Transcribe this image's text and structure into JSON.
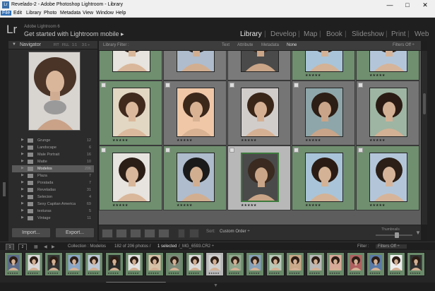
{
  "window": {
    "title": "Revelado-2 - Adobe Photoshop Lightroom - Library",
    "controls": [
      "minimize",
      "maximize",
      "close"
    ]
  },
  "menu": [
    "File",
    "Edit",
    "Library",
    "Photo",
    "Metadata",
    "View",
    "Window",
    "Help"
  ],
  "identity": {
    "logo": "Lr",
    "product": "Adobe Lightroom 6",
    "tagline": "Get started with Lightroom mobile  ▸"
  },
  "modules": [
    "Library",
    "Develop",
    "Map",
    "Book",
    "Slideshow",
    "Print",
    "Web"
  ],
  "active_module": "Library",
  "navigator": {
    "title": "Navigator",
    "options": [
      "FIT",
      "FILL",
      "1:1",
      "3:1 ÷"
    ]
  },
  "folders": [
    {
      "name": "Grunge",
      "count": "12"
    },
    {
      "name": "Landscape",
      "count": "6"
    },
    {
      "name": "Male Portrait",
      "count": "16"
    },
    {
      "name": "Matte",
      "count": "10"
    },
    {
      "name": "Modelos",
      "count": "206",
      "selected": true
    },
    {
      "name": "Plaza",
      "count": "7"
    },
    {
      "name": "Poratada",
      "count": "7"
    },
    {
      "name": "Reveladas",
      "count": "31"
    },
    {
      "name": "Selecion",
      "count": "4"
    },
    {
      "name": "Sexy Capitan America",
      "count": "69"
    },
    {
      "name": "texturas",
      "count": "5"
    },
    {
      "name": "Vintage",
      "count": "11"
    }
  ],
  "panel_buttons": {
    "import": "Import...",
    "export": "Export..."
  },
  "library_filter": {
    "label": "Library Filter :",
    "tabs": [
      "Text",
      "Attribute",
      "Metadata",
      "None"
    ],
    "active": "None",
    "filter_state": "Filters Off ÷"
  },
  "grid": {
    "rows": [
      [
        {
          "stars": "",
          "color": "#6f8f6f"
        },
        {
          "stars": "",
          "color": "#7a7a7a"
        },
        {
          "stars": "",
          "color": "#7a7a7a"
        },
        {
          "stars": "★★★★★",
          "color": "#6f8f6f"
        },
        {
          "stars": "★★★★★",
          "color": "#6f8f6f"
        }
      ],
      [
        {
          "stars": "★★★★★",
          "color": "#6f8f6f"
        },
        {
          "stars": "★★★★★",
          "color": "#757575"
        },
        {
          "stars": "★★★★★",
          "color": "#757575"
        },
        {
          "stars": "★★★★★",
          "color": "#757575"
        },
        {
          "stars": "★★★★★",
          "color": "#757575"
        }
      ],
      [
        {
          "stars": "★★★★★",
          "color": "#6f8f6f"
        },
        {
          "stars": "★★★★★",
          "color": "#6f8f6f"
        },
        {
          "stars": "★★★★★",
          "color": "#b8b8b8"
        },
        {
          "stars": "★★★★★",
          "color": "#6f8f6f"
        },
        {
          "stars": "★★★★★",
          "color": "#6f8f6f"
        }
      ]
    ]
  },
  "toolbar": {
    "sort_label": "Sort:",
    "sort_value": "Custom Order ÷",
    "thumbnails_label": "Thumbnails"
  },
  "filmstrip_bar": {
    "page1": "1",
    "page2": "2",
    "source": "Collection : Modelos",
    "count": "182 of 206 photos /",
    "selected": "1 selected",
    "filename": "/_MG_6593.CR2 ÷",
    "filter_label": "Filter :",
    "filter_value": "Filters Off ÷"
  },
  "filmstrip": {
    "count": 21,
    "selected_index": 10
  },
  "colors": {
    "bg": "#1e1e1e",
    "panel": "#2b2b2b",
    "grid_bg": "#5d5d5d",
    "cell": "#757575",
    "cell_selected": "#b8b8b8",
    "label_green": "#6f8f6f",
    "accent": "#2d6db5"
  }
}
